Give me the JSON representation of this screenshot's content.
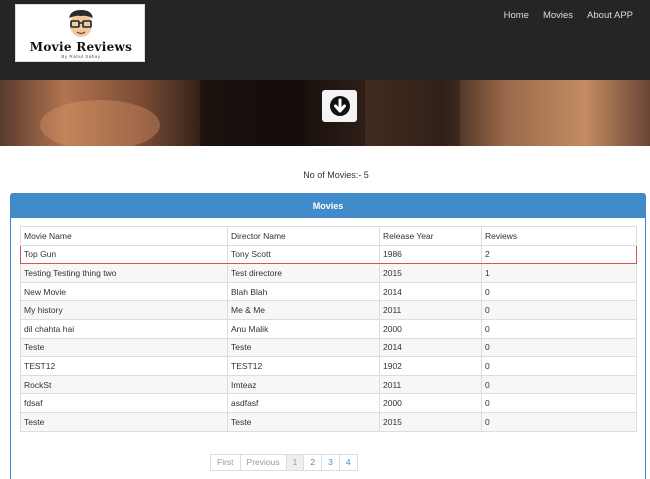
{
  "brand": {
    "title": "Movie Reviews",
    "subtitle": "By Rahul Sahay"
  },
  "nav": {
    "items": [
      "Home",
      "Movies",
      "About APP"
    ]
  },
  "count_text": "No of Movies:- 5",
  "panel": {
    "title": "Movies"
  },
  "table": {
    "headers": [
      "Movie Name",
      "Director Name",
      "Release Year",
      "Reviews"
    ],
    "rows": [
      [
        "Top Gun",
        "Tony Scott",
        "1986",
        "2"
      ],
      [
        "Testing Testing thing two",
        "Test directore",
        "2015",
        "1"
      ],
      [
        "New Movie",
        "Blah Blah",
        "2014",
        "0"
      ],
      [
        "My history",
        "Me & Me",
        "2011",
        "0"
      ],
      [
        "dil chahta hai",
        "Anu Malik",
        "2000",
        "0"
      ],
      [
        "Teste",
        "Teste",
        "2014",
        "0"
      ],
      [
        "TEST12",
        "TEST12",
        "1902",
        "0"
      ],
      [
        "RockSt",
        "Imteaz",
        "2011",
        "0"
      ],
      [
        "fdsaf",
        "asdfasf",
        "2000",
        "0"
      ],
      [
        "Teste",
        "Teste",
        "2015",
        "0"
      ]
    ]
  },
  "pagination": {
    "first": "First",
    "previous": "Previous",
    "pages": [
      "1",
      "2",
      "3",
      "4"
    ],
    "current": "1"
  },
  "colors": {
    "header_bg": "#252525",
    "panel_blue": "#428bca",
    "selected_border": "#d9534f"
  },
  "icons": {
    "scroll_down": "arrow-down-circle-icon",
    "logo": "glasses-face-icon"
  }
}
